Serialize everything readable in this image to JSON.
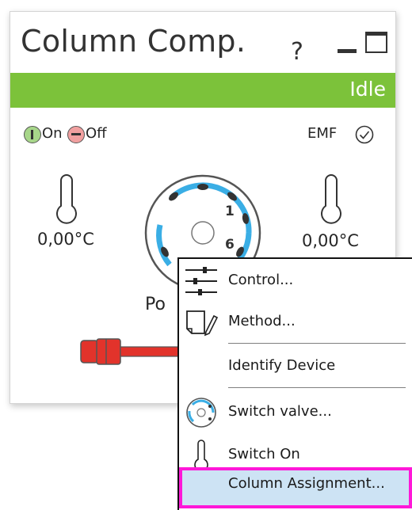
{
  "panel": {
    "title": "Column Comp.",
    "help": "?",
    "status": "Idle",
    "status_color": "#7cc23a",
    "on_label": "On",
    "off_label": "Off",
    "emf_label": "EMF",
    "left_temperature": "0,00°C",
    "right_temperature": "0,00°C",
    "valve_positions": [
      "1",
      "6"
    ],
    "port_label": "Po"
  },
  "context_menu": {
    "items": [
      {
        "label": "Control...",
        "icon": "control-sliders-icon"
      },
      {
        "label": "Method...",
        "icon": "method-edit-icon"
      },
      {
        "label": "Identify Device",
        "icon": ""
      },
      {
        "label": "Switch valve...",
        "icon": "switch-valve-icon"
      },
      {
        "label": "Switch On",
        "icon": "thermometer-icon"
      },
      {
        "label": "Column Assignment...",
        "icon": ""
      }
    ],
    "highlight_color": "#ff18d8"
  }
}
